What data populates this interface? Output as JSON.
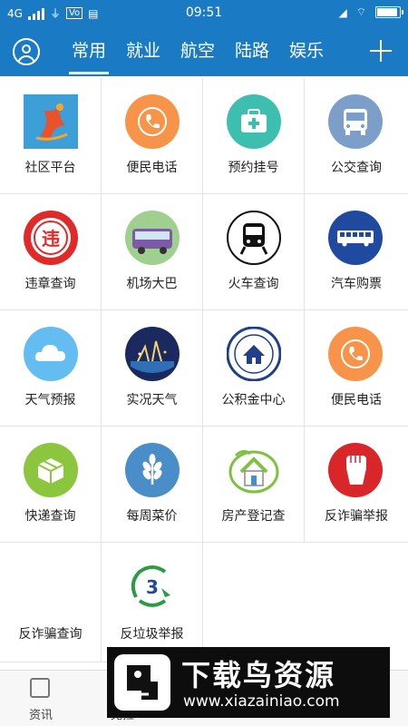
{
  "status_bar": {
    "network": "4G",
    "time": "09:51",
    "volte": "Vo"
  },
  "header": {
    "tabs": [
      {
        "label": "常用",
        "active": true
      },
      {
        "label": "就业",
        "active": false
      },
      {
        "label": "航空",
        "active": false
      },
      {
        "label": "陆路",
        "active": false
      },
      {
        "label": "娱乐",
        "active": false
      }
    ],
    "avatar_icon": "user-icon",
    "add_icon": "plus-icon"
  },
  "grid": {
    "items": [
      {
        "label": "社区平台",
        "icon": "community-platform-icon"
      },
      {
        "label": "便民电话",
        "icon": "phone-icon"
      },
      {
        "label": "预约挂号",
        "icon": "medical-kit-icon"
      },
      {
        "label": "公交查询",
        "icon": "bus-icon"
      },
      {
        "label": "违章查询",
        "icon": "violation-icon"
      },
      {
        "label": "机场大巴",
        "icon": "airport-bus-icon"
      },
      {
        "label": "火车查询",
        "icon": "train-icon"
      },
      {
        "label": "汽车购票",
        "icon": "coach-icon"
      },
      {
        "label": "天气预报",
        "icon": "cloud-icon"
      },
      {
        "label": "实况天气",
        "icon": "live-weather-icon"
      },
      {
        "label": "公积金中心",
        "icon": "housing-fund-icon"
      },
      {
        "label": "便民电话",
        "icon": "phone-icon"
      },
      {
        "label": "快递查询",
        "icon": "package-icon"
      },
      {
        "label": "每周菜价",
        "icon": "wheat-icon"
      },
      {
        "label": "房产登记查",
        "icon": "house-icon"
      },
      {
        "label": "反诈骗举报",
        "icon": "fist-icon"
      },
      {
        "label": "反诈骗查询",
        "icon": ""
      },
      {
        "label": "反垃圾举报",
        "icon": "anti-spam-icon"
      }
    ]
  },
  "bottom_nav": {
    "items": [
      {
        "label": "资讯",
        "icon": "news-icon"
      },
      {
        "label": "克拉",
        "icon": ""
      }
    ]
  },
  "watermark": {
    "title": "下载鸟资源",
    "url": "www.xiazainiao.com"
  },
  "colors": {
    "brand_blue": "#1a7bc4",
    "orange": "#f7944a",
    "teal": "#3cbfae",
    "red": "#e02a2a",
    "navy": "#1f4aa0",
    "sky": "#63bdf0",
    "green": "#8cc63f"
  }
}
